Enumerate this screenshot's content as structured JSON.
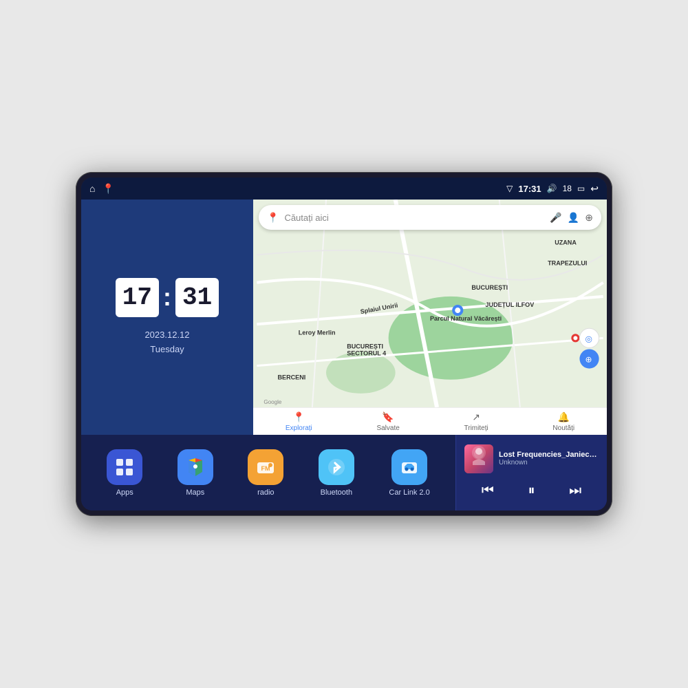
{
  "device": {
    "status_bar": {
      "left_icons": [
        "home",
        "maps-pin"
      ],
      "time": "17:31",
      "signal_icon": "signal",
      "volume_icon": "volume",
      "volume_level": "18",
      "battery_icon": "battery",
      "back_icon": "back"
    },
    "clock": {
      "hours": "17",
      "minutes": "31",
      "date": "2023.12.12",
      "day": "Tuesday"
    },
    "map": {
      "search_placeholder": "Căutați aici",
      "bottom_items": [
        {
          "label": "Explorați",
          "active": true
        },
        {
          "label": "Salvate",
          "active": false
        },
        {
          "label": "Trimiteți",
          "active": false
        },
        {
          "label": "Noutăți",
          "active": false
        }
      ],
      "places": [
        "Parcul Natural Văcărești",
        "Leroy Merlin",
        "BUCUREȘTI SECTORUL 4",
        "BUCUREȘTI",
        "JUDEȚUL ILFOV",
        "BERCENI",
        "Splaiul Unirii",
        "TRAPEZULUI",
        "UZANA"
      ]
    },
    "apps": [
      {
        "id": "apps",
        "label": "Apps",
        "icon_class": "icon-apps",
        "symbol": "⊞"
      },
      {
        "id": "maps",
        "label": "Maps",
        "icon_class": "icon-maps",
        "symbol": "📍"
      },
      {
        "id": "radio",
        "label": "radio",
        "icon_class": "icon-radio",
        "symbol": "FM"
      },
      {
        "id": "bluetooth",
        "label": "Bluetooth",
        "icon_class": "icon-bluetooth",
        "symbol": "⚡"
      },
      {
        "id": "carlink",
        "label": "Car Link 2.0",
        "icon_class": "icon-carlink",
        "symbol": "🚗"
      }
    ],
    "music": {
      "title": "Lost Frequencies_Janieck Devy-...",
      "artist": "Unknown",
      "controls": {
        "prev": "⏮",
        "play_pause": "⏸",
        "next": "⏭"
      }
    }
  }
}
